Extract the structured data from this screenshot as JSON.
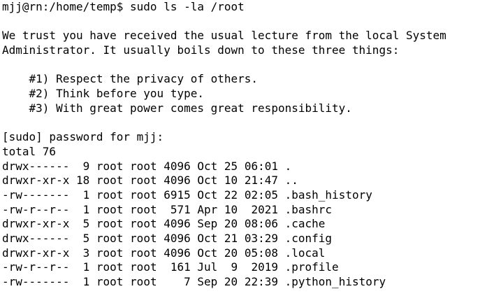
{
  "terminal": {
    "prompt": "mjj@rn:/home/temp$ ",
    "command": "sudo ls -la /root",
    "lecture": [
      "",
      "We trust you have received the usual lecture from the local System",
      "Administrator. It usually boils down to these three things:",
      "",
      "    #1) Respect the privacy of others.",
      "    #2) Think before you type.",
      "    #3) With great power comes great responsibility.",
      ""
    ],
    "password_prompt": "[sudo] password for mjj:",
    "total_line": "total 76",
    "listing": [
      {
        "perms": "drwx------",
        "links": " 9",
        "owner": "root",
        "group": "root",
        "size": "4096",
        "date": "Oct 25 06:01",
        "name": "."
      },
      {
        "perms": "drwxr-xr-x",
        "links": "18",
        "owner": "root",
        "group": "root",
        "size": "4096",
        "date": "Oct 10 21:47",
        "name": ".."
      },
      {
        "perms": "-rw-------",
        "links": " 1",
        "owner": "root",
        "group": "root",
        "size": "6915",
        "date": "Oct 22 02:05",
        "name": ".bash_history"
      },
      {
        "perms": "-rw-r--r--",
        "links": " 1",
        "owner": "root",
        "group": "root",
        "size": " 571",
        "date": "Apr 10  2021",
        "name": ".bashrc"
      },
      {
        "perms": "drwxr-xr-x",
        "links": " 5",
        "owner": "root",
        "group": "root",
        "size": "4096",
        "date": "Sep 20 08:06",
        "name": ".cache"
      },
      {
        "perms": "drwx------",
        "links": " 5",
        "owner": "root",
        "group": "root",
        "size": "4096",
        "date": "Oct 21 03:29",
        "name": ".config"
      },
      {
        "perms": "drwxr-xr-x",
        "links": " 3",
        "owner": "root",
        "group": "root",
        "size": "4096",
        "date": "Oct 20 05:08",
        "name": ".local"
      },
      {
        "perms": "-rw-r--r--",
        "links": " 1",
        "owner": "root",
        "group": "root",
        "size": " 161",
        "date": "Jul  9  2019",
        "name": ".profile"
      },
      {
        "perms": "-rw-------",
        "links": " 1",
        "owner": "root",
        "group": "root",
        "size": "   7",
        "date": "Sep 20 22:39",
        "name": ".python_history"
      }
    ]
  }
}
